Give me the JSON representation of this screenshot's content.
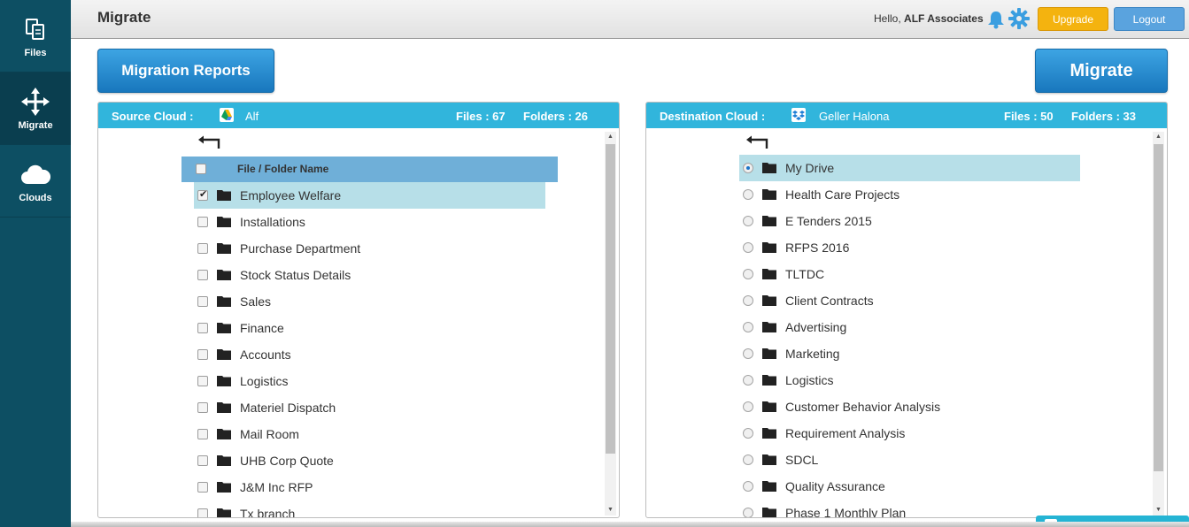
{
  "sidebar": {
    "items": [
      {
        "label": "Files",
        "icon": "files-icon",
        "active": false
      },
      {
        "label": "Migrate",
        "icon": "migrate-icon",
        "active": true
      },
      {
        "label": "Clouds",
        "icon": "cloud-icon",
        "active": false
      }
    ]
  },
  "header": {
    "title": "Migrate",
    "hello_prefix": "Hello,",
    "user_name": "ALF Associates",
    "upgrade_label": "Upgrade",
    "logout_label": "Logout"
  },
  "actions": {
    "reports_label": "Migration Reports",
    "migrate_label": "Migrate"
  },
  "source": {
    "label": "Source Cloud :",
    "cloud_icon": "google-drive-icon",
    "account": "Alf",
    "files_text": "Files : 67",
    "folders_text": "Folders : 26",
    "column_header": "File / Folder Name",
    "items": [
      {
        "name": "Employee Welfare",
        "checked": true
      },
      {
        "name": "Installations",
        "checked": false
      },
      {
        "name": "Purchase Department",
        "checked": false
      },
      {
        "name": "Stock Status Details",
        "checked": false
      },
      {
        "name": "Sales",
        "checked": false
      },
      {
        "name": "Finance",
        "checked": false
      },
      {
        "name": "Accounts",
        "checked": false
      },
      {
        "name": "Logistics",
        "checked": false
      },
      {
        "name": "Materiel Dispatch",
        "checked": false
      },
      {
        "name": "Mail Room",
        "checked": false
      },
      {
        "name": "UHB Corp Quote",
        "checked": false
      },
      {
        "name": "J&M Inc RFP",
        "checked": false
      },
      {
        "name": "Tx branch",
        "checked": false
      }
    ]
  },
  "destination": {
    "label": "Destination Cloud :",
    "cloud_icon": "dropbox-icon",
    "account": "Geller Halona",
    "files_text": "Files : 50",
    "folders_text": "Folders : 33",
    "items": [
      {
        "name": "My Drive",
        "selected": true
      },
      {
        "name": "Health Care Projects",
        "selected": false
      },
      {
        "name": "E Tenders 2015",
        "selected": false
      },
      {
        "name": "RFPS 2016",
        "selected": false
      },
      {
        "name": "TLTDC",
        "selected": false
      },
      {
        "name": "Client Contracts",
        "selected": false
      },
      {
        "name": "Advertising",
        "selected": false
      },
      {
        "name": "Marketing",
        "selected": false
      },
      {
        "name": "Logistics",
        "selected": false
      },
      {
        "name": "Customer Behavior Analysis",
        "selected": false
      },
      {
        "name": "Requirement Analysis",
        "selected": false
      },
      {
        "name": "SDCL",
        "selected": false
      },
      {
        "name": "Quality Assurance",
        "selected": false
      },
      {
        "name": "Phase 1 Monthly Plan",
        "selected": false
      }
    ]
  },
  "colors": {
    "sidebar": "#0d4f63",
    "panel_header": "#31b5dc",
    "selected_row": "#b7dfe8",
    "upgrade": "#f4b30f",
    "logout": "#5aa3de"
  }
}
